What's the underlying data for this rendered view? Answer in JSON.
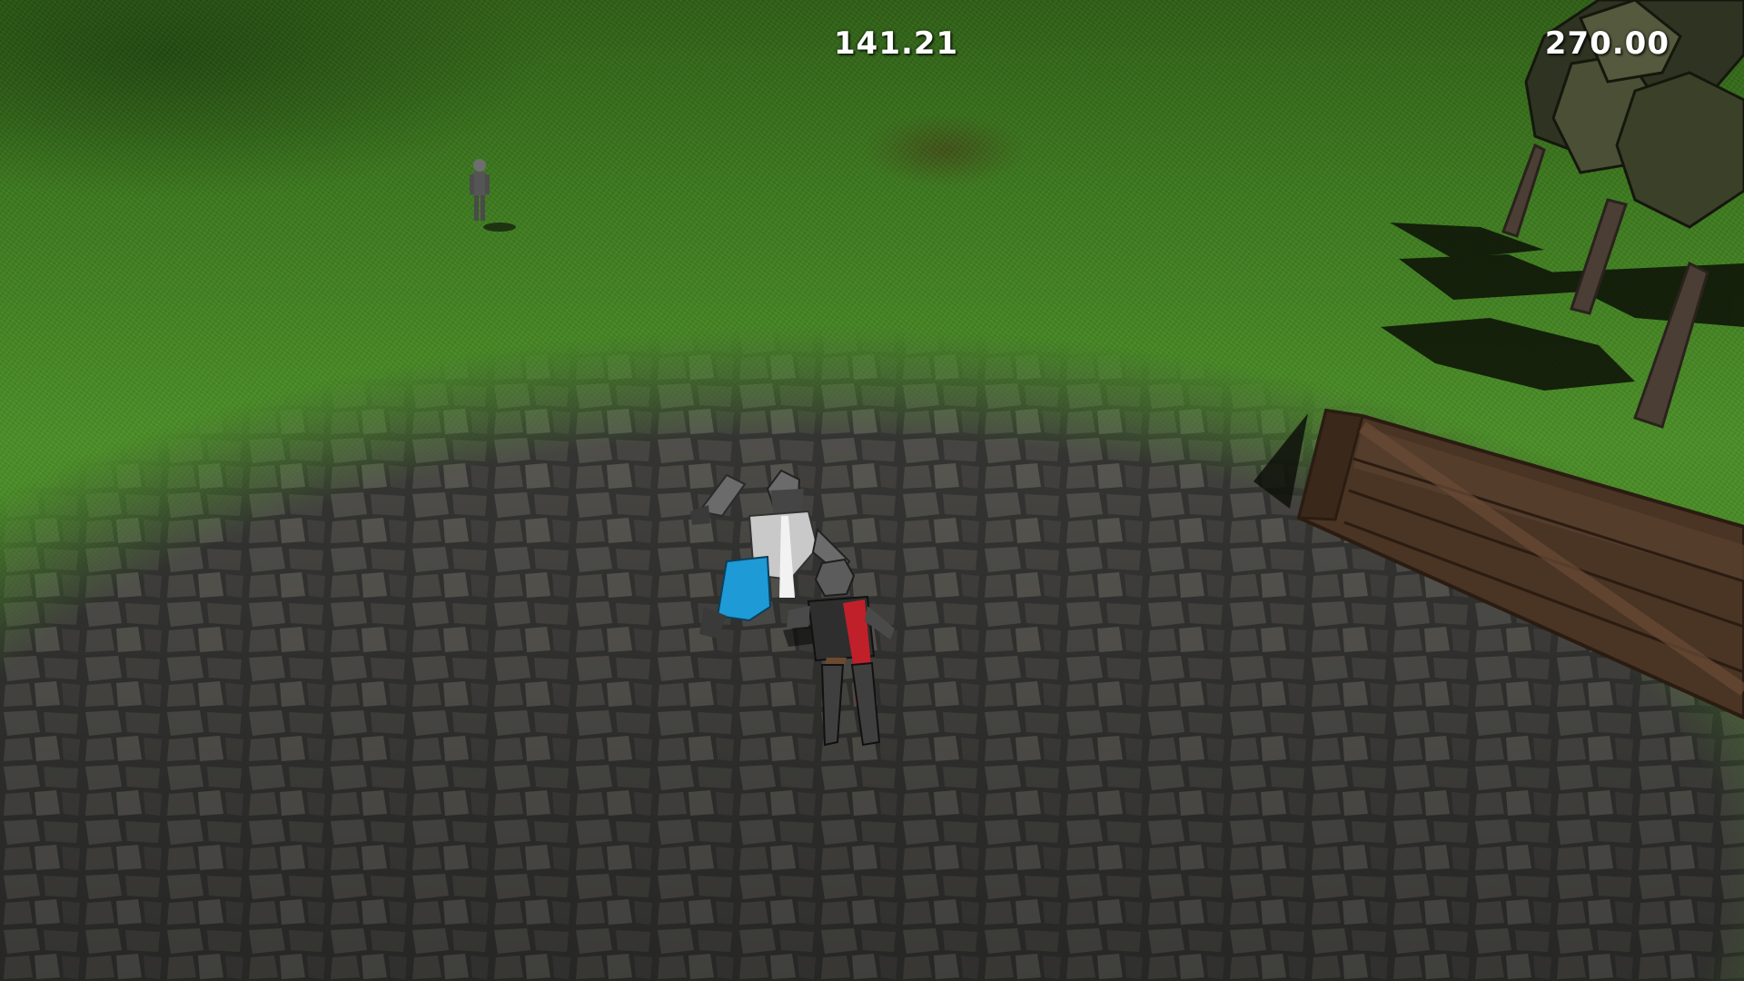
{
  "hud": {
    "timer": "141.21",
    "score": "270.00"
  },
  "colors": {
    "grass": "#4b8f27",
    "stone": "#4a4a48",
    "player_accent": "#1e9ad6",
    "enemy_accent": "#c0202a",
    "crate_wood": "#4a3424",
    "tree_foliage": "#3c3f2a"
  }
}
